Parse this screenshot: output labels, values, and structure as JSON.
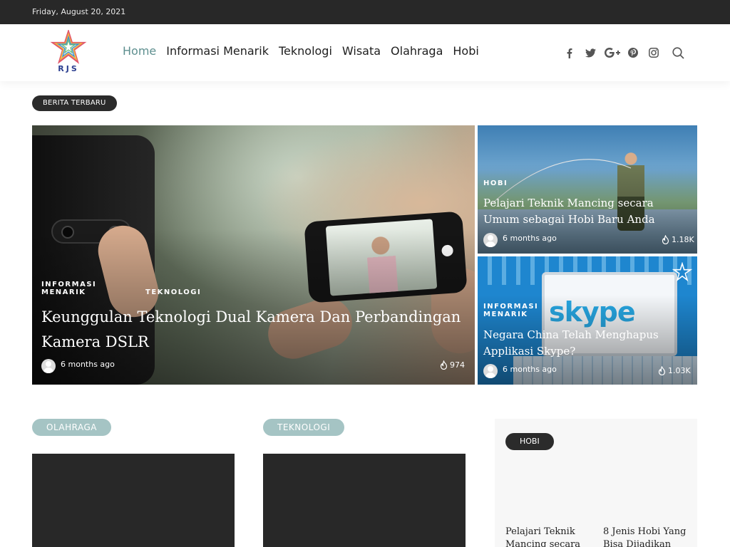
{
  "topbar": {
    "date": "Friday, August 20, 2021"
  },
  "logo": {
    "text": "RJS"
  },
  "nav": {
    "items": [
      {
        "label": "Home",
        "active": true
      },
      {
        "label": "Informasi Menarik",
        "active": false
      },
      {
        "label": "Teknologi",
        "active": false
      },
      {
        "label": "Wisata",
        "active": false
      },
      {
        "label": "Olahraga",
        "active": false
      },
      {
        "label": "Hobi",
        "active": false
      }
    ]
  },
  "social_icons": [
    "facebook-icon",
    "twitter-icon",
    "google-plus-icon",
    "pinterest-icon",
    "instagram-icon",
    "search-icon"
  ],
  "section": {
    "label": "BERITA TERBARU"
  },
  "hero": {
    "categories": [
      "INFORMASI MENARIK",
      "TEKNOLOGI"
    ],
    "title": "Keunggulan Teknologi Dual Kamera Dan Perbandingan Kamera DSLR",
    "time": "6 months ago",
    "views": "974"
  },
  "side_posts": [
    {
      "category": "HOBI",
      "title": "Pelajari Teknik Mancing secara Umum sebagai Hobi Baru Anda",
      "time": "6 months ago",
      "views": "1.18K"
    },
    {
      "category": "INFORMASI MENARIK",
      "title": "Negara China Telah Menghapus Applikasi Skype?",
      "time": "6 months ago",
      "views": "1.03K",
      "image_text": "skype"
    }
  ],
  "lower": {
    "col1_label": "OLAHRAGA",
    "col2_label": "TEKNOLOGI",
    "hobi_label": "HOBI",
    "hobi_posts": [
      "Pelajari Teknik Mancing secara",
      "8 Jenis Hobi Yang Bisa Dijadikan"
    ]
  },
  "colors": {
    "topbar": "#282828",
    "nav_active": "#5e8f8f",
    "pill_teal": "#a5c4c4",
    "pill_dark": "#2b2b2b"
  }
}
